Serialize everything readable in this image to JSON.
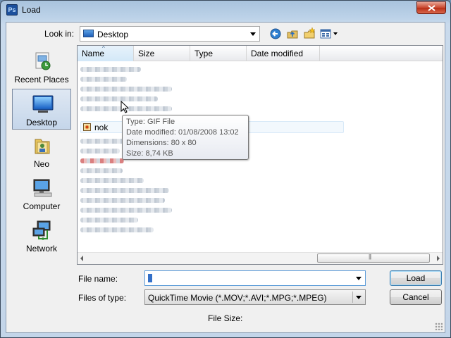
{
  "window": {
    "title": "Load",
    "app_icon": "Ps"
  },
  "toolbar": {
    "look_in_label": "Look in:",
    "look_in_value": "Desktop",
    "icons": [
      "back-icon",
      "up-folder-icon",
      "new-folder-icon",
      "views-menu-icon"
    ]
  },
  "places": [
    {
      "label": "Recent Places",
      "icon": "recent-places-icon"
    },
    {
      "label": "Desktop",
      "icon": "desktop-icon",
      "selected": true
    },
    {
      "label": "Neo",
      "icon": "user-folder-icon"
    },
    {
      "label": "Computer",
      "icon": "computer-icon"
    },
    {
      "label": "Network",
      "icon": "network-icon"
    }
  ],
  "columns": [
    "Name",
    "Size",
    "Type",
    "Date modified"
  ],
  "files": {
    "hovered_name": "nok",
    "hovered_icon": "gif-file-icon"
  },
  "tooltip": {
    "type": "Type: GIF File",
    "date": "Date modified: 01/08/2008 13:02",
    "dimensions": "Dimensions: 80 x 80",
    "size": "Size: 8,74 KB"
  },
  "form": {
    "file_name_label": "File name:",
    "file_name_value": "",
    "files_of_type_label": "Files of type:",
    "files_of_type_value": "QuickTime Movie (*.MOV;*.AVI;*.MPG;*.MPEG)",
    "file_size_label": "File Size:"
  },
  "buttons": {
    "load": "Load",
    "cancel": "Cancel"
  }
}
